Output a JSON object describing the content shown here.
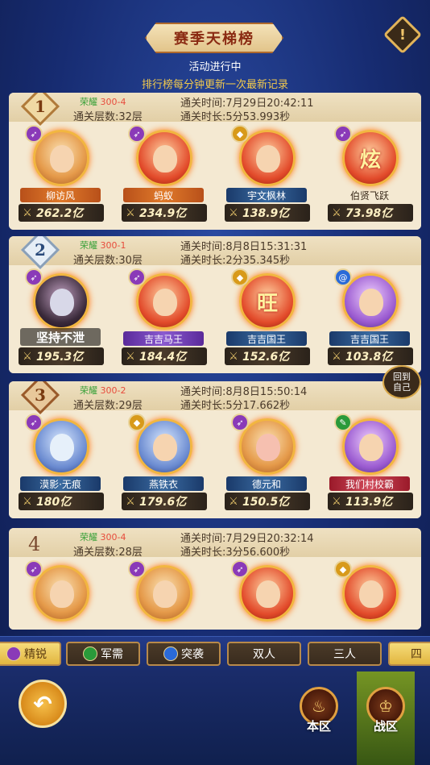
{
  "header": {
    "title": "赛季天梯榜",
    "help_icon": "!",
    "status": "活动进行中",
    "notice": "排行榜每分钟更新一次最新记录"
  },
  "entries": [
    {
      "rank": "1",
      "server_prefix": "荣耀",
      "server": "300-4",
      "floors": "通关层数:32层",
      "pass_time": "通关时间:7月29日20:42:11",
      "pass_duration": "通关时长:5分53.993秒",
      "heroes": [
        {
          "name": "柳访风",
          "power": "262.2亿",
          "class_icon": "bow-icon"
        },
        {
          "name": "蚂蚁",
          "power": "234.9亿",
          "class_icon": "bow-icon"
        },
        {
          "name": "宇文枫林",
          "power": "138.9亿",
          "class_icon": "shield-icon"
        },
        {
          "name": "伯贤飞跃",
          "power": "73.98亿",
          "class_icon": "bow-icon",
          "badge_char": "炫"
        }
      ]
    },
    {
      "rank": "2",
      "server_prefix": "荣耀",
      "server": "300-1",
      "floors": "通关层数:30层",
      "pass_time": "通关时间:8月8日15:31:31",
      "pass_duration": "通关时长:2分35.345秒",
      "heroes": [
        {
          "name": "坚持不泄",
          "power": "195.3亿",
          "class_icon": "bow-icon",
          "overlay": "坚持不泄"
        },
        {
          "name": "吉吉马王",
          "power": "184.4亿",
          "class_icon": "bow-icon"
        },
        {
          "name": "吉吉国王",
          "power": "152.6亿",
          "class_icon": "shield-icon",
          "badge_char": "旺"
        },
        {
          "name": "吉吉国王",
          "power": "103.8亿",
          "class_icon": "swirl-icon"
        }
      ]
    },
    {
      "rank": "3",
      "server_prefix": "荣耀",
      "server": "300-2",
      "floors": "通关层数:29层",
      "pass_time": "通关时间:8月8日15:50:14",
      "pass_duration": "通关时长:5分17.662秒",
      "heroes": [
        {
          "name": "漠影·无痕",
          "power": "180亿",
          "class_icon": "bow-icon"
        },
        {
          "name": "燕铁衣",
          "power": "179.6亿",
          "class_icon": "shield-icon"
        },
        {
          "name": "德元和",
          "power": "150.5亿",
          "class_icon": "bow-icon"
        },
        {
          "name": "我们村校霸",
          "power": "113.9亿",
          "class_icon": "leaf-icon"
        }
      ]
    },
    {
      "rank": "4",
      "server_prefix": "荣耀",
      "server": "300-4",
      "floors": "通关层数:28层",
      "pass_time": "通关时间:7月29日20:32:14",
      "pass_duration": "通关时长:3分56.600秒",
      "heroes": [
        {
          "name": "",
          "power": "",
          "class_icon": "bow-icon"
        },
        {
          "name": "",
          "power": "",
          "class_icon": "bow-icon"
        },
        {
          "name": "",
          "power": "",
          "class_icon": "bow-icon"
        },
        {
          "name": "",
          "power": "",
          "class_icon": "shield-icon"
        }
      ]
    }
  ],
  "back_to_self": {
    "line1": "回到",
    "line2": "自己"
  },
  "tabs": [
    {
      "label": "精锐",
      "icon": "bow-icon"
    },
    {
      "label": "军需",
      "icon": "leaf-icon"
    },
    {
      "label": "突袭",
      "icon": "swirl-icon"
    },
    {
      "label": "双人"
    },
    {
      "label": "三人"
    },
    {
      "label": "四"
    }
  ],
  "bottom_nav": {
    "back_icon": "back-arrow-icon",
    "local_label": "本区",
    "war_label": "战区"
  }
}
